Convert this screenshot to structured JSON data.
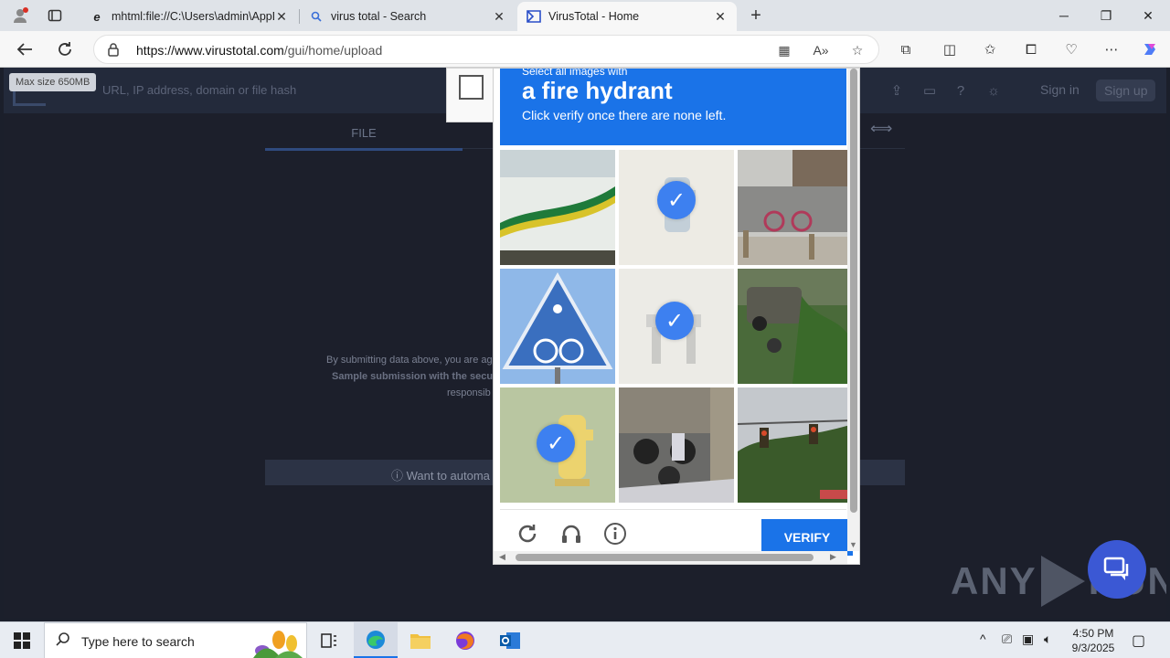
{
  "browser": {
    "tabs": [
      {
        "title": "mhtml:file://C:\\Users\\admin\\AppD",
        "icon": "ie-icon",
        "active": false
      },
      {
        "title": "virus total - Search",
        "icon": "search-icon",
        "active": false
      },
      {
        "title": "VirusTotal - Home",
        "icon": "virustotal-icon",
        "active": true
      }
    ],
    "url_host": "https://www.virustotal.com",
    "url_path": "/gui/home/upload"
  },
  "page": {
    "tooltip": "Max size 650MB",
    "search_placeholder": "URL, IP address, domain or file hash",
    "sign_in": "Sign in",
    "sign_up": "Sign up",
    "file_tab": "FILE",
    "terms_line1": "By submitting data above, you are ag",
    "terms_line2": "Sample submission with the secu",
    "terms_line3": "responsib",
    "automate": "ⓘ Want to automa"
  },
  "captcha": {
    "pre": "Select all images with",
    "target": "a fire hydrant",
    "instruction": "Click verify once there are none left.",
    "verify": "VERIFY",
    "tiles": [
      {
        "desc": "bus",
        "selected": false
      },
      {
        "desc": "hydrant",
        "selected": true
      },
      {
        "desc": "storefront",
        "selected": false
      },
      {
        "desc": "sign",
        "selected": false
      },
      {
        "desc": "hydrant",
        "selected": true
      },
      {
        "desc": "car",
        "selected": false
      },
      {
        "desc": "hydrant",
        "selected": true
      },
      {
        "desc": "motorcycles",
        "selected": false
      },
      {
        "desc": "traffic-lights",
        "selected": false
      }
    ]
  },
  "watermark": {
    "left": "ANY",
    "right": "RUN"
  },
  "taskbar": {
    "search_placeholder": "Type here to search",
    "time": "4:50 PM",
    "date": "9/3/2025"
  }
}
